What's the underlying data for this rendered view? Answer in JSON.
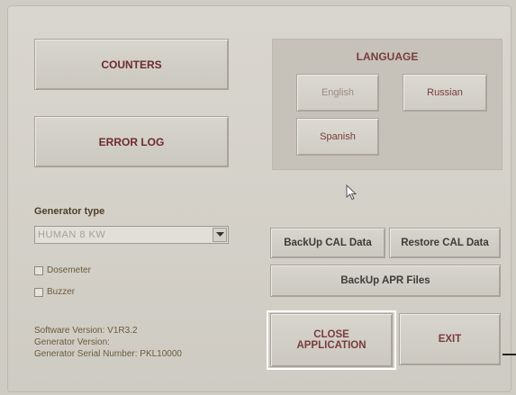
{
  "buttons": {
    "counters": "COUNTERS",
    "error_log": "ERROR LOG",
    "backup_cal": "BackUp CAL Data",
    "restore_cal": "Restore CAL Data",
    "backup_apr": "BackUp APR Files",
    "close_app_line1": "CLOSE",
    "close_app_line2": "APPLICATION",
    "exit": "EXIT"
  },
  "language": {
    "title": "LANGUAGE",
    "options": [
      "English",
      "Russian",
      "Spanish"
    ],
    "selected": "English"
  },
  "generator": {
    "label": "Generator type",
    "value": "HUMAN 8 KW"
  },
  "checkboxes": {
    "dosemeter": "Dosemeter",
    "buzzer": "Buzzer"
  },
  "info": {
    "software_version": "Software Version: V1R3.2",
    "generator_version": "Generator Version:",
    "serial_number": "Generator Serial Number: PKL10000"
  },
  "colors": {
    "accent_text": "#6e2a2c",
    "panel_bg": "#c6c2ba",
    "focus_frame": "#ffffff"
  },
  "icons": [
    "dropdown-arrow-icon",
    "mouse-pointer-icon"
  ]
}
